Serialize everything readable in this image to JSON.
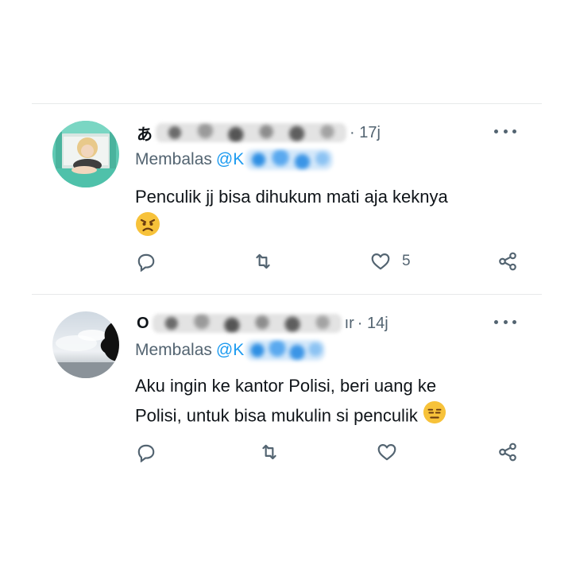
{
  "tweets": [
    {
      "name_first_char": "あ",
      "name_tail": "",
      "time": "· 17j",
      "reply_prefix": "Membalas",
      "reply_handle": "@K",
      "text": "Penculik jj bisa dihukum mati aja keknya",
      "emoji": "angry-face",
      "like_count": "5",
      "icons": {
        "reply": "reply-icon",
        "retweet": "retweet-icon",
        "like": "heart-icon",
        "share": "share-icon",
        "more": "more-icon"
      }
    },
    {
      "name_first_char": "O",
      "name_tail": "ır",
      "time": "· 14j",
      "reply_prefix": "Membalas",
      "reply_handle": "@K",
      "text_line1": "Aku ingin ke kantor Polisi, beri uang ke",
      "text_line2": "Polisi, untuk bisa mukulin si penculik",
      "emoji": "expressionless-face",
      "like_count": "",
      "icons": {
        "reply": "reply-icon",
        "retweet": "retweet-icon",
        "like": "heart-icon",
        "share": "share-icon",
        "more": "more-icon"
      }
    }
  ],
  "colors": {
    "text": "#0f1419",
    "muted": "#536471",
    "link": "#1d9bf0",
    "divider": "#e7e9ea",
    "emoji": "#f7c23a"
  }
}
